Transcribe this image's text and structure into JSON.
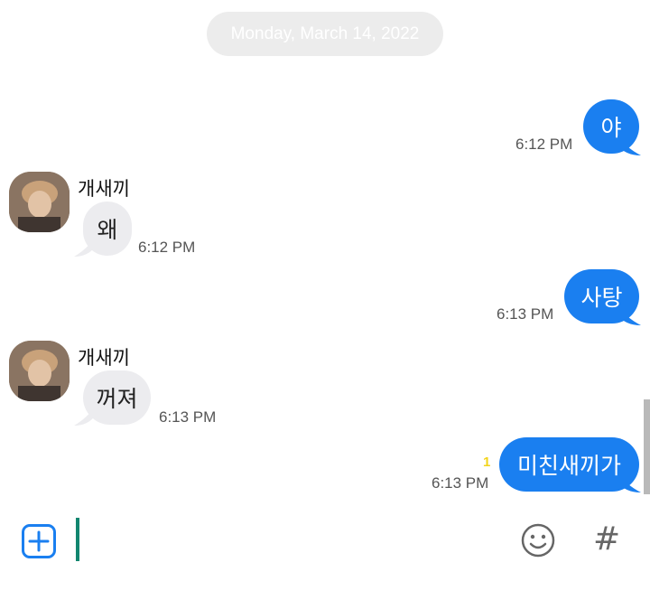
{
  "chat": {
    "date_separator": "Monday, March 14, 2022",
    "messages": [
      {
        "direction": "out",
        "text": "야",
        "time": "6:12 PM"
      },
      {
        "direction": "in",
        "sender": "개새끼",
        "text": "왜",
        "time": "6:12 PM"
      },
      {
        "direction": "out",
        "text": "사탕",
        "time": "6:13 PM"
      },
      {
        "direction": "in",
        "sender": "개새끼",
        "text": "꺼져",
        "time": "6:13 PM"
      },
      {
        "direction": "out",
        "text": "미친새끼가",
        "time": "6:13 PM",
        "unread_count": "1"
      }
    ]
  },
  "composer": {
    "plus_icon": "plus-square-icon",
    "emoji_icon": "smiley-icon",
    "hash_label": "#"
  },
  "colors": {
    "outgoing_bubble": "#1a7ff0",
    "incoming_bubble": "#ececef",
    "cursor": "#11866f",
    "unread": "#f2d41c"
  }
}
